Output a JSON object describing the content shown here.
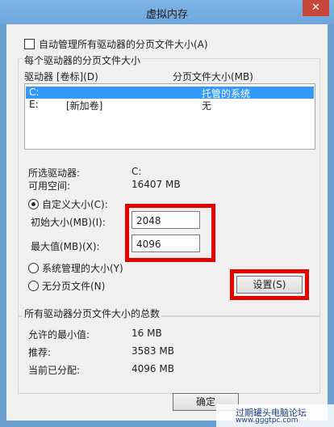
{
  "window": {
    "title": "虚拟内存",
    "close_glyph": "✕"
  },
  "auto_manage": {
    "label": "自动管理所有驱动器的分页文件大小(A)",
    "checked": false
  },
  "per_drive_group": {
    "title": "每个驱动器的分页文件大小",
    "col_drive": "驱动器 [卷标](D)",
    "col_size": "分页文件大小(MB)",
    "rows": [
      {
        "drive": "C:",
        "label": "",
        "size": "托管的系统",
        "selected": true
      },
      {
        "drive": "E:",
        "label": "[新加卷]",
        "size": "无",
        "selected": false
      }
    ]
  },
  "selected_drive": {
    "label": "所选驱动器:",
    "value": "C:"
  },
  "free_space": {
    "label": "可用空间:",
    "value": "16407 MB"
  },
  "custom_size": {
    "label": "自定义大小(C):",
    "checked": true
  },
  "initial_size": {
    "label": "初始大小(MB)(I):",
    "value": "2048"
  },
  "max_size": {
    "label": "最大值(MB)(X):",
    "value": "4096"
  },
  "system_managed": {
    "label": "系统管理的大小(Y)",
    "checked": false
  },
  "no_paging": {
    "label": "无分页文件(N)",
    "checked": false
  },
  "set_button": {
    "label": "设置(S)"
  },
  "totals_group": {
    "title": "所有驱动器分页文件大小的总数",
    "min_label": "允许的最小值:",
    "min_value": "16 MB",
    "rec_label": "推荐:",
    "rec_value": "3583 MB",
    "cur_label": "当前已分配:",
    "cur_value": "4096 MB"
  },
  "ok_button": {
    "label": "确定"
  },
  "watermark": {
    "text": "过期罐头电脑论坛",
    "url": "www.gggtpc.com"
  },
  "colors": {
    "highlight_red": "#e50000",
    "selection": "#3399ff"
  }
}
